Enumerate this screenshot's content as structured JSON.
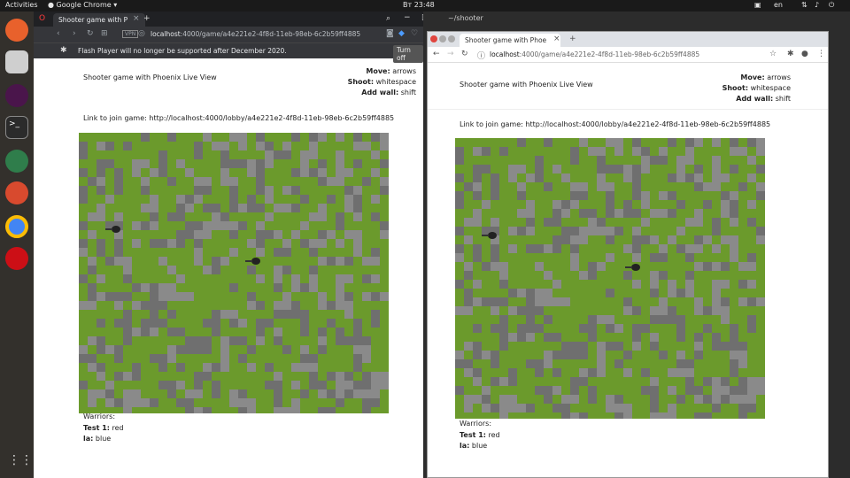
{
  "system": {
    "activities": "Activities",
    "app_name": "Google Chrome",
    "clock": "Вт 23:48",
    "lang": "en"
  },
  "background_window_title": "~/shooter",
  "window_a": {
    "tab_title": "Shooter game with P",
    "address": "localhost:4000/game/a4e221e2-4f8d-11eb-98eb-6c2b59ff4885",
    "address_host": "localhost",
    "address_rest": ":4000/game/a4e221e2-4f8d-11eb-98eb-6c2b59ff4885",
    "flash_message": "Flash Player will no longer be supported after December 2020.",
    "flash_button": "Turn off"
  },
  "window_b": {
    "tab_title": "Shooter game with Phoe",
    "address_host": "localhost",
    "address_rest": ":4000/game/a4e221e2-4f8d-11eb-98eb-6c2b59ff4885"
  },
  "page": {
    "title": "Shooter game with Phoenix Live View",
    "move_label": "Move:",
    "move_value": "arrows",
    "shoot_label": "Shoot:",
    "shoot_value": "whitespace",
    "wall_label": "Add wall:",
    "wall_value": "shift",
    "link_text": "Link to join game: http://localhost:4000/lobby/a4e221e2-4f8d-11eb-98eb-6c2b59ff4885",
    "warriors_label": "Warriors:",
    "players": [
      {
        "name": "Test 1:",
        "color": "red"
      },
      {
        "name": "la:",
        "color": "blue"
      }
    ]
  },
  "colors": {
    "grass": "#6b9a2c",
    "wall": "#7a7a7a",
    "accent_blue": "#1a73e8"
  }
}
